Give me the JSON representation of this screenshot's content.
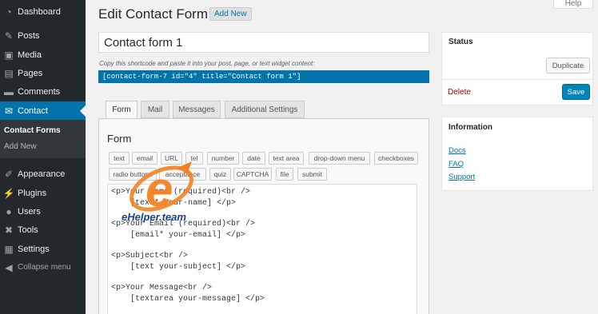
{
  "sidebar": {
    "items": [
      {
        "label": "Dashboard",
        "icon": "dashboard-icon"
      },
      {
        "label": "Posts",
        "icon": "pin-icon"
      },
      {
        "label": "Media",
        "icon": "media-icon"
      },
      {
        "label": "Pages",
        "icon": "page-icon"
      },
      {
        "label": "Comments",
        "icon": "comment-icon"
      },
      {
        "label": "Contact",
        "icon": "mail-icon"
      },
      {
        "label": "Appearance",
        "icon": "brush-icon"
      },
      {
        "label": "Plugins",
        "icon": "plug-icon"
      },
      {
        "label": "Users",
        "icon": "user-icon"
      },
      {
        "label": "Tools",
        "icon": "wrench-icon"
      },
      {
        "label": "Settings",
        "icon": "settings-icon"
      },
      {
        "label": "Collapse menu",
        "icon": "collapse-icon"
      }
    ],
    "submenu": {
      "current": "Contact Forms",
      "other": "Add New"
    },
    "accent_color": "#0073aa"
  },
  "header": {
    "title": "Edit Contact Form",
    "add_new": "Add New",
    "help": "Help"
  },
  "form": {
    "title_value": "Contact form 1",
    "shortcode_hint": "Copy this shortcode and paste it into your post, page, or text widget content:",
    "shortcode": "[contact-form-7 id=\"4\" title=\"Contact form 1\"]"
  },
  "tabs": [
    "Form",
    "Mail",
    "Messages",
    "Additional Settings"
  ],
  "panel": {
    "title": "Form",
    "tag_buttons_row1": [
      "text",
      "email",
      "URL",
      "tel",
      "number",
      "date",
      "text area",
      "drop-down menu",
      "checkboxes"
    ],
    "tag_buttons_row2": [
      "radio buttons",
      "acceptance",
      "quiz",
      "CAPTCHA",
      "file",
      "submit"
    ],
    "code_lines": [
      "<p>Your Name (required)<br />",
      "    [text* your-name] </p>",
      "",
      "<p>Your Email (required)<br />",
      "    [email* your-email] </p>",
      "",
      "<p>Subject<br />",
      "    [text your-subject] </p>",
      "",
      "<p>Your Message<br />",
      "    [textarea your-message] </p>"
    ]
  },
  "status_box": {
    "title": "Status",
    "duplicate": "Duplicate",
    "delete": "Delete",
    "save": "Save"
  },
  "info_box": {
    "title": "Information",
    "links": [
      "Docs",
      "FAQ",
      "Support"
    ]
  },
  "watermark": {
    "text": "eHelper.team",
    "colors": [
      "#f58220",
      "#1e3f8a"
    ]
  }
}
